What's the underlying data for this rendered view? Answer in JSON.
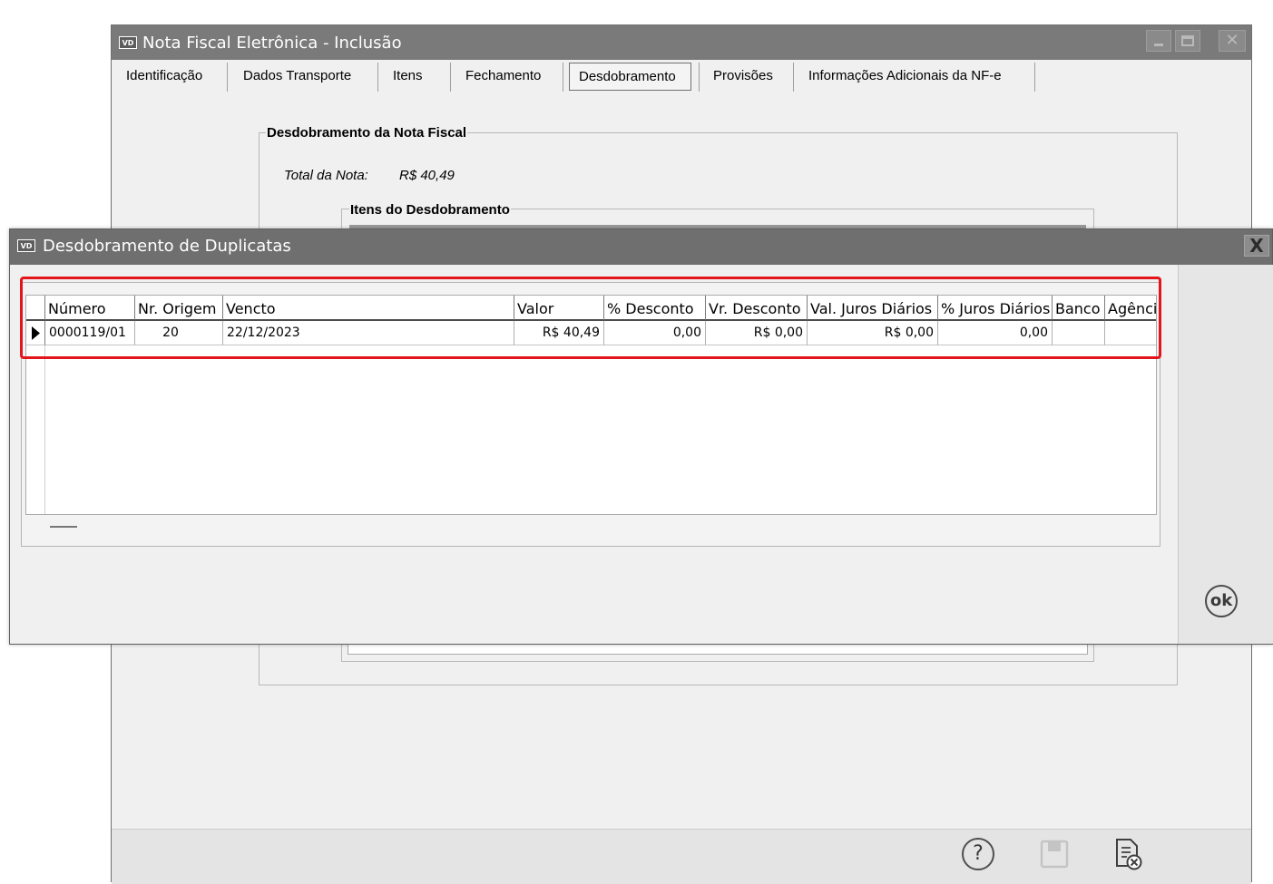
{
  "back_window": {
    "app_icon": "VD",
    "title": "Nota Fiscal Eletrônica - Inclusão",
    "tabs": [
      {
        "label": "Identificação"
      },
      {
        "label": "Dados Transporte"
      },
      {
        "label": "Itens"
      },
      {
        "label": "Fechamento"
      },
      {
        "label": "Desdobramento",
        "active": true
      },
      {
        "label": "Provisões"
      },
      {
        "label": "Informações Adicionais da NF-e"
      }
    ],
    "group_title": "Desdobramento da Nota Fiscal",
    "total_label": "Total da Nota:",
    "total_value": "R$ 40,49",
    "items_group_title": "Itens do Desdobramento",
    "icons": [
      "help-icon",
      "save-icon",
      "cancel-document-icon"
    ]
  },
  "dialog": {
    "app_icon": "VD",
    "title": "Desdobramento de Duplicatas",
    "close_label": "X",
    "ok_label": "ok",
    "columns": [
      "Número",
      "Nr. Origem",
      "Vencto",
      "Valor",
      "% Desconto",
      "Vr. Desconto",
      "Val. Juros Diários",
      "% Juros Diários",
      "Banco",
      "Agência"
    ],
    "rows": [
      {
        "numero": "0000119/01",
        "nr_origem": "20",
        "vencto": "22/12/2023",
        "valor": "R$ 40,49",
        "pct_desconto": "0,00",
        "vr_desconto": "R$ 0,00",
        "val_juros": "R$ 0,00",
        "pct_juros": "0,00",
        "banco": "",
        "agencia": ""
      }
    ]
  },
  "colors": {
    "highlight": "#e3151b",
    "titlebar": "#6f6f6f"
  }
}
